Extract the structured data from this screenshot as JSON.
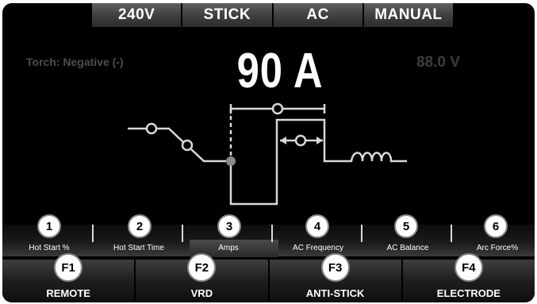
{
  "top_tabs": [
    {
      "label": "240V"
    },
    {
      "label": "STICK"
    },
    {
      "label": "AC"
    },
    {
      "label": "MANUAL"
    }
  ],
  "status": {
    "torch": "Torch: Negative (-)",
    "amps": "90 A",
    "volts": "88.0 V"
  },
  "parameters": [
    {
      "number": "1",
      "label": "Hot Start %"
    },
    {
      "number": "2",
      "label": "Hot Start Time"
    },
    {
      "number": "3",
      "label": "Amps",
      "selected": true
    },
    {
      "number": "4",
      "label": "AC Frequency"
    },
    {
      "number": "5",
      "label": "AC Balance"
    },
    {
      "number": "6",
      "label": "Arc Force%"
    }
  ],
  "function_keys": [
    {
      "key": "F1",
      "label": "REMOTE"
    },
    {
      "key": "F2",
      "label": "VRD"
    },
    {
      "key": "F3",
      "label": "ANTI-STICK"
    },
    {
      "key": "F4",
      "label": "ELECTRODE"
    }
  ],
  "colors": {
    "background": "#000000",
    "text": "#ffffff",
    "dim_text": "#4d4d4d"
  }
}
